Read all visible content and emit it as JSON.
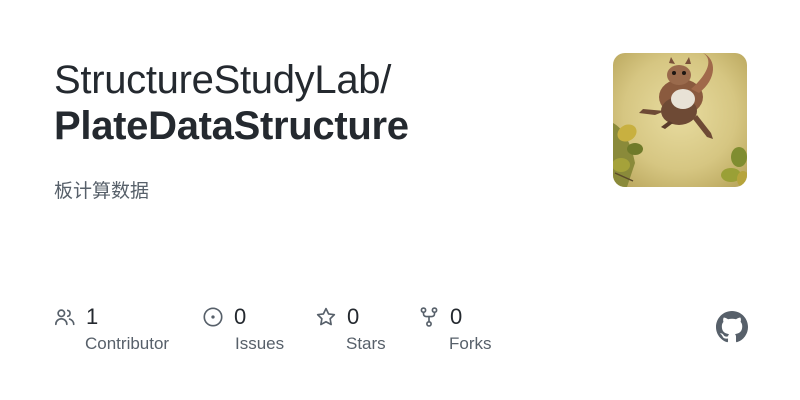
{
  "repo": {
    "owner": "StructureStudyLab/",
    "name": "PlateDataStructure",
    "description": "板计算数据"
  },
  "avatar": {
    "subject": "squirrel leaping over autumn leaves"
  },
  "stats": [
    {
      "value": "1",
      "label": "Contributor",
      "icon": "people-icon"
    },
    {
      "value": "0",
      "label": "Issues",
      "icon": "issue-icon"
    },
    {
      "value": "0",
      "label": "Stars",
      "icon": "star-icon"
    },
    {
      "value": "0",
      "label": "Forks",
      "icon": "fork-icon"
    }
  ],
  "brand": {
    "logo": "github-logo-icon",
    "color": "#24292f",
    "muted_color": "#57606a"
  }
}
